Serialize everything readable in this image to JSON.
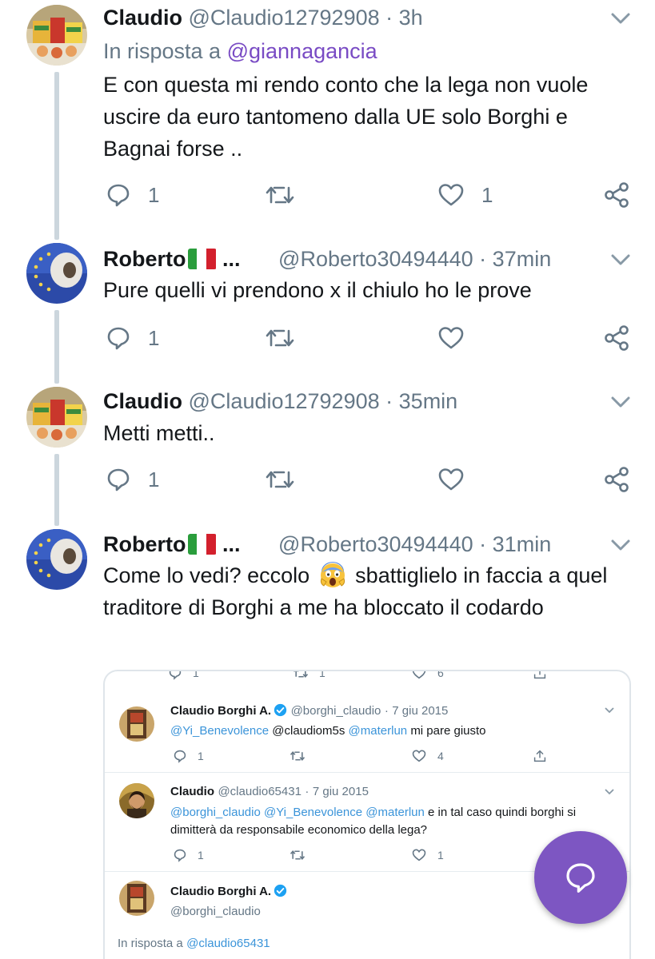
{
  "theme": {
    "accent": "#794bc4",
    "grey": "#657786",
    "fab": "#7d56c2"
  },
  "tweets": [
    {
      "name": "Claudio",
      "handle": "@Claudio12792908",
      "time": "3h",
      "reply_prefix": "In risposta a",
      "reply_to": "@giannagancia",
      "text": "E con questa mi rendo conto che la lega non vuole uscire da euro tantomeno dalla UE solo Borghi e Bagnai forse ..",
      "replies": "1",
      "likes": "1"
    },
    {
      "name": "Roberto",
      "name_suffix": "...",
      "handle": "@Roberto30494440",
      "time": "37min",
      "text": "Pure quelli vi prendono x il chiulo ho le prove",
      "replies": "1",
      "likes": ""
    },
    {
      "name": "Claudio",
      "handle": "@Claudio12792908",
      "time": "35min",
      "text": "Metti metti..",
      "replies": "1",
      "likes": ""
    },
    {
      "name": "Roberto",
      "name_suffix": "...",
      "handle": "@Roberto30494440",
      "time": "31min",
      "text_before": "Come lo vedi? eccolo",
      "text_after": "sbattiglielo in faccia a quel traditore di Borghi a me ha bloccato il codardo",
      "replies": "",
      "likes": ""
    }
  ],
  "embed": {
    "top_counts": {
      "replies": "1",
      "retweets": "1",
      "likes": "6"
    },
    "t1": {
      "name": "Claudio Borghi A.",
      "handle": "@borghi_claudio",
      "date": "7 giu 2015",
      "m1": "@Yi_Benevolence",
      "m2": "@claudiom5s",
      "m3": "@materlun",
      "text": "mi pare giusto",
      "replies": "1",
      "likes": "4"
    },
    "t2": {
      "name": "Claudio",
      "handle": "@claudio65431",
      "date": "7 giu 2015",
      "m1": "@borghi_claudio",
      "m2": "@Yi_Benevolence",
      "m3": "@materlun",
      "text1": "e in tal caso quindi borghi si",
      "text2": "dimitterà da responsabile economico della lega?",
      "replies": "1",
      "likes": "1"
    },
    "t3": {
      "name": "Claudio Borghi A.",
      "handle": "@borghi_claudio",
      "reply_prefix": "In risposta a",
      "reply_to": "@claudio65431"
    }
  }
}
